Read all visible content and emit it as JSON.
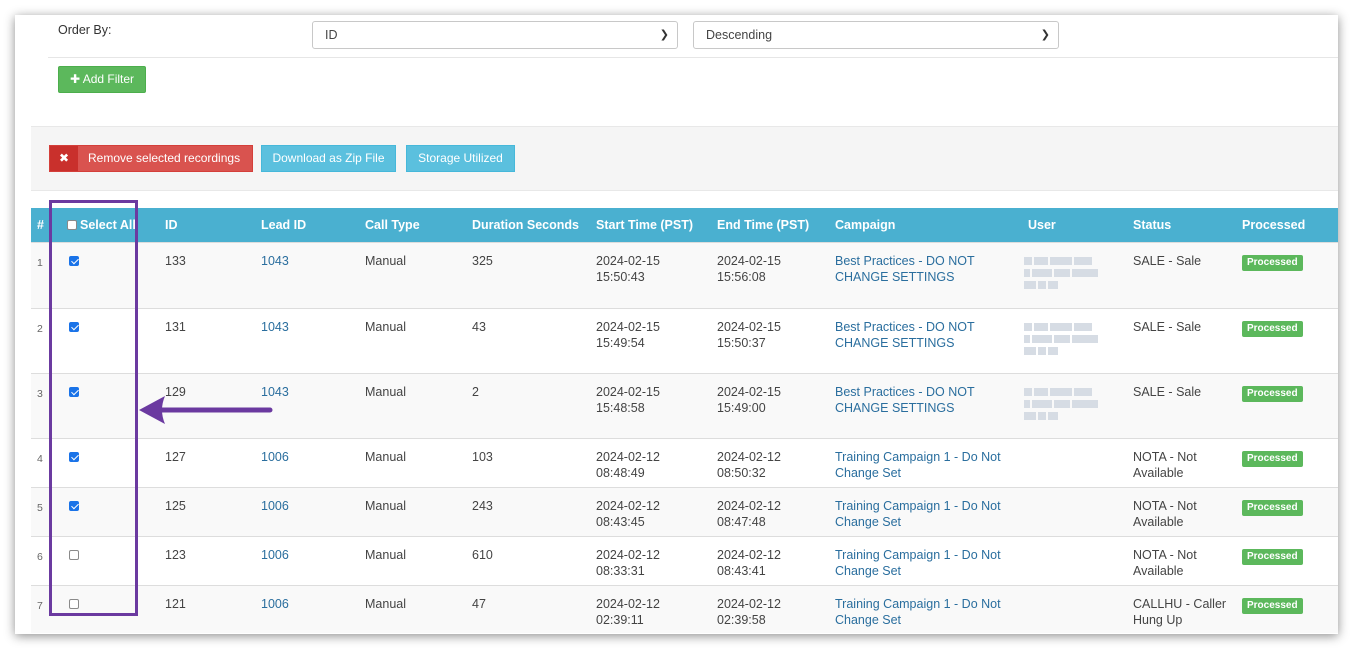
{
  "filters": {
    "order_by_label": "Order By:",
    "order_field": "ID",
    "order_direction": "Descending",
    "add_filter_label": "Add Filter"
  },
  "actions": {
    "remove_label": "Remove selected recordings",
    "download_label": "Download as Zip File",
    "storage_label": "Storage Utilized"
  },
  "table": {
    "headers": {
      "num": "#",
      "select_all": "Select All",
      "id": "ID",
      "lead_id": "Lead ID",
      "call_type": "Call Type",
      "duration": "Duration Seconds",
      "start": "Start Time (PST)",
      "end": "End Time (PST)",
      "campaign": "Campaign",
      "user": "User",
      "status": "Status",
      "processed": "Processed"
    },
    "rows": [
      {
        "num": "1",
        "checked": true,
        "id": "133",
        "lead_id": "1043",
        "call_type": "Manual",
        "duration": "325",
        "start_date": "2024-02-15",
        "start_time": "15:50:43",
        "end_date": "2024-02-15",
        "end_time": "15:56:08",
        "campaign_1": "Best Practices - DO NOT",
        "campaign_2": "CHANGE SETTINGS",
        "user_blurred": true,
        "status_1": "SALE - Sale",
        "status_2": "",
        "processed": "Processed"
      },
      {
        "num": "2",
        "checked": true,
        "id": "131",
        "lead_id": "1043",
        "call_type": "Manual",
        "duration": "43",
        "start_date": "2024-02-15",
        "start_time": "15:49:54",
        "end_date": "2024-02-15",
        "end_time": "15:50:37",
        "campaign_1": "Best Practices - DO NOT",
        "campaign_2": "CHANGE SETTINGS",
        "user_blurred": true,
        "status_1": "SALE - Sale",
        "status_2": "",
        "processed": "Processed"
      },
      {
        "num": "3",
        "checked": true,
        "id": "129",
        "lead_id": "1043",
        "call_type": "Manual",
        "duration": "2",
        "start_date": "2024-02-15",
        "start_time": "15:48:58",
        "end_date": "2024-02-15",
        "end_time": "15:49:00",
        "campaign_1": "Best Practices - DO NOT",
        "campaign_2": "CHANGE SETTINGS",
        "user_blurred": true,
        "status_1": "SALE - Sale",
        "status_2": "",
        "processed": "Processed"
      },
      {
        "num": "4",
        "checked": true,
        "id": "127",
        "lead_id": "1006",
        "call_type": "Manual",
        "duration": "103",
        "start_date": "2024-02-12",
        "start_time": "08:48:49",
        "end_date": "2024-02-12",
        "end_time": "08:50:32",
        "campaign_1": "Training Campaign 1 - Do Not",
        "campaign_2": "Change Set",
        "user_blurred": false,
        "status_1": "NOTA - Not",
        "status_2": "Available",
        "processed": "Processed"
      },
      {
        "num": "5",
        "checked": true,
        "id": "125",
        "lead_id": "1006",
        "call_type": "Manual",
        "duration": "243",
        "start_date": "2024-02-12",
        "start_time": "08:43:45",
        "end_date": "2024-02-12",
        "end_time": "08:47:48",
        "campaign_1": "Training Campaign 1 - Do Not",
        "campaign_2": "Change Set",
        "user_blurred": false,
        "status_1": "NOTA - Not",
        "status_2": "Available",
        "processed": "Processed"
      },
      {
        "num": "6",
        "checked": false,
        "id": "123",
        "lead_id": "1006",
        "call_type": "Manual",
        "duration": "610",
        "start_date": "2024-02-12",
        "start_time": "08:33:31",
        "end_date": "2024-02-12",
        "end_time": "08:43:41",
        "campaign_1": "Training Campaign 1 - Do Not",
        "campaign_2": "Change Set",
        "user_blurred": false,
        "status_1": "NOTA - Not",
        "status_2": "Available",
        "processed": "Processed"
      },
      {
        "num": "7",
        "checked": false,
        "id": "121",
        "lead_id": "1006",
        "call_type": "Manual",
        "duration": "47",
        "start_date": "2024-02-12",
        "start_time": "02:39:11",
        "end_date": "2024-02-12",
        "end_time": "02:39:58",
        "campaign_1": "Training Campaign 1 - Do Not",
        "campaign_2": "Change Set",
        "user_blurred": false,
        "status_1": "CALLHU - Caller",
        "status_2": "Hung Up",
        "processed": "Processed"
      }
    ]
  },
  "colors": {
    "header_bg": "#4ab0d0",
    "processed_badge": "#5cb85c",
    "remove_button": "#d9534f",
    "info_button": "#5bc0de",
    "annotation": "#6b3aa0",
    "link": "#2a6e9e"
  },
  "icons": {
    "add_filter": "plus-icon",
    "remove": "x-icon",
    "select": "chevron-down-icon",
    "annotation": "arrow-left-icon"
  }
}
